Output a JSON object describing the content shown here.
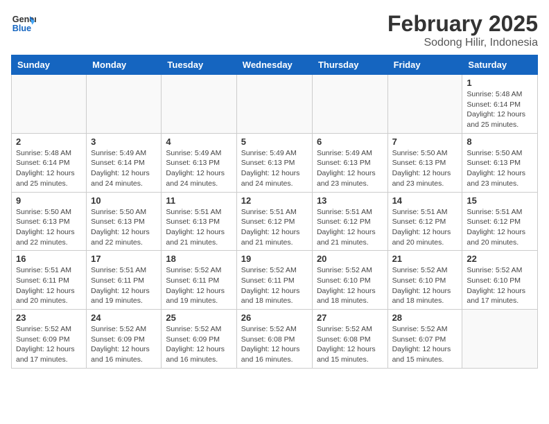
{
  "logo": {
    "line1": "General",
    "line2": "Blue"
  },
  "title": "February 2025",
  "location": "Sodong Hilir, Indonesia",
  "weekdays": [
    "Sunday",
    "Monday",
    "Tuesday",
    "Wednesday",
    "Thursday",
    "Friday",
    "Saturday"
  ],
  "days": [
    {
      "date": "",
      "info": ""
    },
    {
      "date": "",
      "info": ""
    },
    {
      "date": "",
      "info": ""
    },
    {
      "date": "",
      "info": ""
    },
    {
      "date": "",
      "info": ""
    },
    {
      "date": "",
      "info": ""
    },
    {
      "date": "1",
      "info": "Sunrise: 5:48 AM\nSunset: 6:14 PM\nDaylight: 12 hours\nand 25 minutes."
    },
    {
      "date": "2",
      "info": "Sunrise: 5:48 AM\nSunset: 6:14 PM\nDaylight: 12 hours\nand 25 minutes."
    },
    {
      "date": "3",
      "info": "Sunrise: 5:49 AM\nSunset: 6:14 PM\nDaylight: 12 hours\nand 24 minutes."
    },
    {
      "date": "4",
      "info": "Sunrise: 5:49 AM\nSunset: 6:13 PM\nDaylight: 12 hours\nand 24 minutes."
    },
    {
      "date": "5",
      "info": "Sunrise: 5:49 AM\nSunset: 6:13 PM\nDaylight: 12 hours\nand 24 minutes."
    },
    {
      "date": "6",
      "info": "Sunrise: 5:49 AM\nSunset: 6:13 PM\nDaylight: 12 hours\nand 23 minutes."
    },
    {
      "date": "7",
      "info": "Sunrise: 5:50 AM\nSunset: 6:13 PM\nDaylight: 12 hours\nand 23 minutes."
    },
    {
      "date": "8",
      "info": "Sunrise: 5:50 AM\nSunset: 6:13 PM\nDaylight: 12 hours\nand 23 minutes."
    },
    {
      "date": "9",
      "info": "Sunrise: 5:50 AM\nSunset: 6:13 PM\nDaylight: 12 hours\nand 22 minutes."
    },
    {
      "date": "10",
      "info": "Sunrise: 5:50 AM\nSunset: 6:13 PM\nDaylight: 12 hours\nand 22 minutes."
    },
    {
      "date": "11",
      "info": "Sunrise: 5:51 AM\nSunset: 6:13 PM\nDaylight: 12 hours\nand 21 minutes."
    },
    {
      "date": "12",
      "info": "Sunrise: 5:51 AM\nSunset: 6:12 PM\nDaylight: 12 hours\nand 21 minutes."
    },
    {
      "date": "13",
      "info": "Sunrise: 5:51 AM\nSunset: 6:12 PM\nDaylight: 12 hours\nand 21 minutes."
    },
    {
      "date": "14",
      "info": "Sunrise: 5:51 AM\nSunset: 6:12 PM\nDaylight: 12 hours\nand 20 minutes."
    },
    {
      "date": "15",
      "info": "Sunrise: 5:51 AM\nSunset: 6:12 PM\nDaylight: 12 hours\nand 20 minutes."
    },
    {
      "date": "16",
      "info": "Sunrise: 5:51 AM\nSunset: 6:11 PM\nDaylight: 12 hours\nand 20 minutes."
    },
    {
      "date": "17",
      "info": "Sunrise: 5:51 AM\nSunset: 6:11 PM\nDaylight: 12 hours\nand 19 minutes."
    },
    {
      "date": "18",
      "info": "Sunrise: 5:52 AM\nSunset: 6:11 PM\nDaylight: 12 hours\nand 19 minutes."
    },
    {
      "date": "19",
      "info": "Sunrise: 5:52 AM\nSunset: 6:11 PM\nDaylight: 12 hours\nand 18 minutes."
    },
    {
      "date": "20",
      "info": "Sunrise: 5:52 AM\nSunset: 6:10 PM\nDaylight: 12 hours\nand 18 minutes."
    },
    {
      "date": "21",
      "info": "Sunrise: 5:52 AM\nSunset: 6:10 PM\nDaylight: 12 hours\nand 18 minutes."
    },
    {
      "date": "22",
      "info": "Sunrise: 5:52 AM\nSunset: 6:10 PM\nDaylight: 12 hours\nand 17 minutes."
    },
    {
      "date": "23",
      "info": "Sunrise: 5:52 AM\nSunset: 6:09 PM\nDaylight: 12 hours\nand 17 minutes."
    },
    {
      "date": "24",
      "info": "Sunrise: 5:52 AM\nSunset: 6:09 PM\nDaylight: 12 hours\nand 16 minutes."
    },
    {
      "date": "25",
      "info": "Sunrise: 5:52 AM\nSunset: 6:09 PM\nDaylight: 12 hours\nand 16 minutes."
    },
    {
      "date": "26",
      "info": "Sunrise: 5:52 AM\nSunset: 6:08 PM\nDaylight: 12 hours\nand 16 minutes."
    },
    {
      "date": "27",
      "info": "Sunrise: 5:52 AM\nSunset: 6:08 PM\nDaylight: 12 hours\nand 15 minutes."
    },
    {
      "date": "28",
      "info": "Sunrise: 5:52 AM\nSunset: 6:07 PM\nDaylight: 12 hours\nand 15 minutes."
    },
    {
      "date": "",
      "info": ""
    }
  ]
}
